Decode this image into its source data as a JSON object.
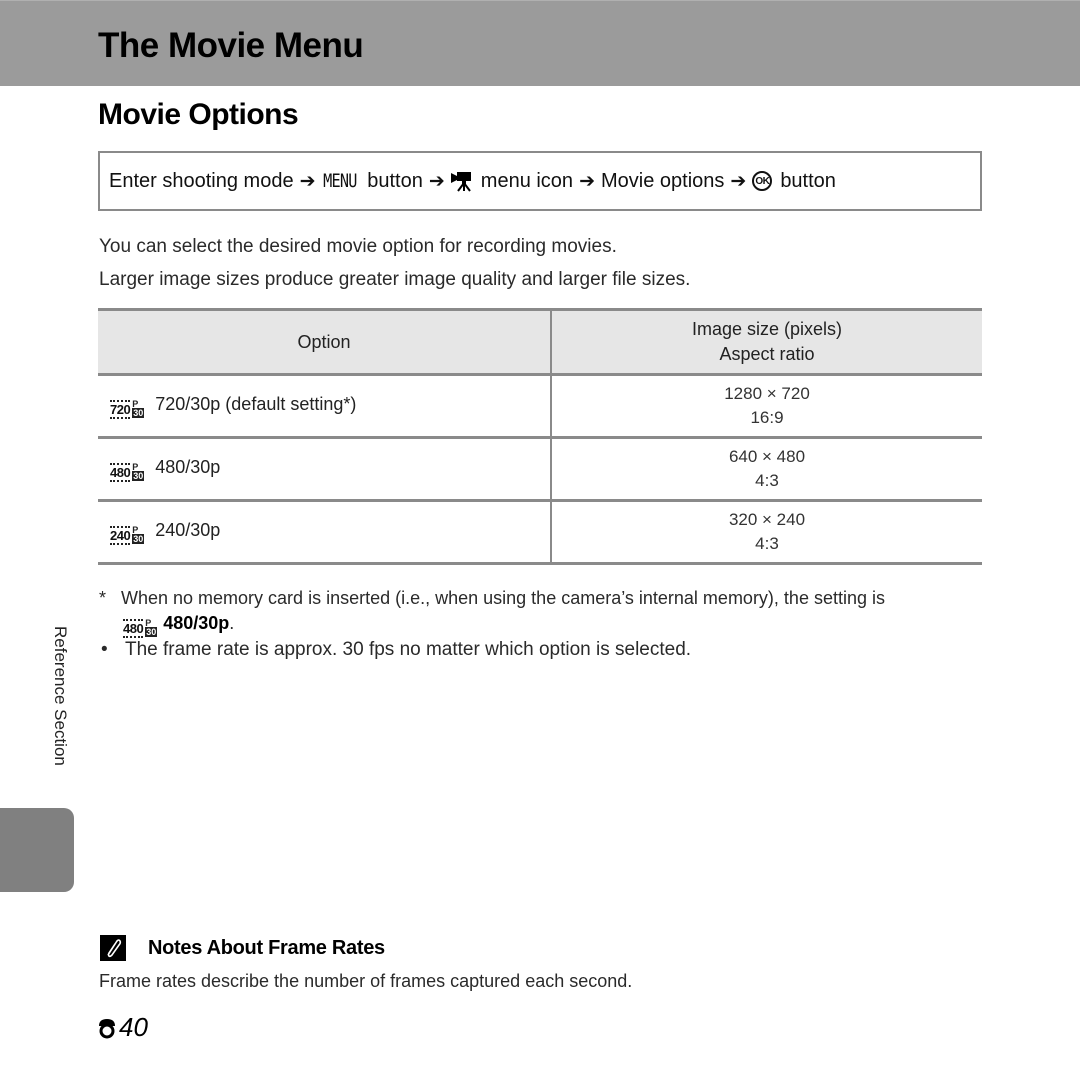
{
  "header": {
    "title": "The Movie Menu",
    "bar_color": "#9b9b9b"
  },
  "section": {
    "title": "Movie Options"
  },
  "navigation": {
    "step1": "Enter shooting mode",
    "menu_button_glyph": "MENU",
    "step2": "button",
    "movie_icon": "movie-camera-icon",
    "step3": "menu icon",
    "step4": "Movie options",
    "ok_glyph": "OK",
    "step5": "button",
    "arrow": "➔"
  },
  "intro": {
    "line1": "You can select the desired movie option for recording movies.",
    "line2": "Larger image sizes produce greater image quality and larger file sizes."
  },
  "table": {
    "header": {
      "option": "Option",
      "size_line1": "Image size (pixels)",
      "size_line2": "Aspect ratio"
    },
    "rows": [
      {
        "icon_res": "720",
        "icon_fps_p": "P",
        "icon_fps": "30",
        "label": "720/30p (default setting*)",
        "size": "1280 × 720",
        "ratio": "16:9"
      },
      {
        "icon_res": "480",
        "icon_fps_p": "P",
        "icon_fps": "30",
        "label": "480/30p",
        "size": "640 × 480",
        "ratio": "4:3"
      },
      {
        "icon_res": "240",
        "icon_fps_p": "P",
        "icon_fps": "30",
        "label": "240/30p",
        "size": "320 × 240",
        "ratio": "4:3"
      }
    ]
  },
  "footnote": {
    "marker": "*",
    "text": "When no memory card is inserted (i.e., when using the camera’s internal memory), the setting is",
    "icon_res": "480",
    "icon_fps_p": "P",
    "icon_fps": "30",
    "value": "480/30p",
    "period": "."
  },
  "bullet": {
    "marker": "•",
    "text": "The frame rate is approx. 30 fps no matter which option is selected."
  },
  "side": {
    "label": "Reference Section",
    "tab_color": "#808080"
  },
  "notes": {
    "icon": "pencil-icon",
    "title": "Notes About Frame Rates",
    "text": "Frame rates describe the number of frames captured each second."
  },
  "page_number": {
    "prefix_icon": "reference-section-icon",
    "number": "40"
  }
}
